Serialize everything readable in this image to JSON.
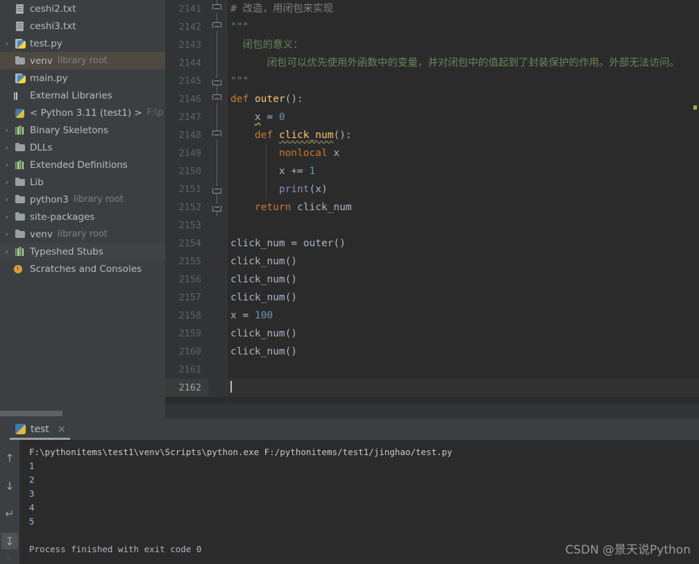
{
  "sidebar": {
    "items": [
      {
        "arrow": "",
        "icon": "text-file-icon",
        "label": "ceshi2.txt",
        "sub": "",
        "state": "normal"
      },
      {
        "arrow": "",
        "icon": "text-file-icon",
        "label": "ceshi3.txt",
        "sub": "",
        "state": "normal"
      },
      {
        "arrow": "›",
        "icon": "python-file-icon",
        "label": "test.py",
        "sub": "",
        "state": "normal"
      },
      {
        "arrow": "",
        "icon": "folder-icon",
        "label": "venv",
        "sub": "library root",
        "state": "selected"
      },
      {
        "arrow": "",
        "icon": "python-file-icon",
        "label": "main.py",
        "sub": "",
        "state": "normal"
      },
      {
        "arrow": "",
        "icon": "external-libraries-icon",
        "label": "External Libraries",
        "sub": "",
        "state": "normal"
      },
      {
        "arrow": "",
        "icon": "python-interpreter-icon",
        "label": "< Python 3.11 (test1) >",
        "sub": "F:\\p",
        "state": "normal"
      },
      {
        "arrow": "›",
        "icon": "library-icon",
        "label": "Binary Skeletons",
        "sub": "",
        "state": "normal"
      },
      {
        "arrow": "›",
        "icon": "folder-icon",
        "label": "DLLs",
        "sub": "",
        "state": "normal"
      },
      {
        "arrow": "›",
        "icon": "library-icon",
        "label": "Extended Definitions",
        "sub": "",
        "state": "normal"
      },
      {
        "arrow": "›",
        "icon": "folder-icon",
        "label": "Lib",
        "sub": "",
        "state": "normal"
      },
      {
        "arrow": "›",
        "icon": "folder-icon",
        "label": "python3",
        "sub": "library root",
        "state": "normal"
      },
      {
        "arrow": "›",
        "icon": "folder-icon",
        "label": "site-packages",
        "sub": "",
        "state": "normal"
      },
      {
        "arrow": "›",
        "icon": "folder-icon",
        "label": "venv",
        "sub": "library root",
        "state": "normal"
      },
      {
        "arrow": "›",
        "icon": "library-icon",
        "label": "Typeshed Stubs",
        "sub": "",
        "state": "hl"
      },
      {
        "arrow": "",
        "icon": "scratches-icon",
        "label": "Scratches and Consoles",
        "sub": "",
        "state": "normal"
      }
    ]
  },
  "editor": {
    "first_line_number": 2141,
    "current_line_number": 2162,
    "lines": [
      {
        "n": "2141",
        "fold": "top",
        "html": "<span class=\"c-comment\"># 改造，用闭包来实现</span>"
      },
      {
        "n": "2142",
        "fold": "top",
        "html": "<span class=\"c-str\">\"\"\"</span>"
      },
      {
        "n": "2143",
        "fold": "line",
        "html": "<span class=\"c-str\">  闭包的意义：</span>"
      },
      {
        "n": "2144",
        "fold": "line",
        "html": "<span class=\"c-str\">      闭包可以优先使用外函数中的变量，并对闭包中的值起到了封装保护的作用。外部无法访问。</span>"
      },
      {
        "n": "2145",
        "fold": "bot",
        "html": "<span class=\"c-str\">\"\"\"</span>"
      },
      {
        "n": "2146",
        "fold": "top",
        "html": "<span class=\"c-kw\">def</span> <span class=\"c-def\">outer</span><span class=\"c-plain\">():</span>"
      },
      {
        "n": "2147",
        "fold": "line",
        "html": "<span class=\"c-plain\">    </span><span class=\"c-plain underwave\">x</span><span class=\"c-plain\"> = </span><span class=\"c-num\">0</span>"
      },
      {
        "n": "2148",
        "fold": "top",
        "html": "<span class=\"c-plain\">    </span><span class=\"c-kw\">def</span> <span class=\"c-def underwave-grey\">click_num</span><span class=\"c-plain\">():</span>"
      },
      {
        "n": "2149",
        "fold": "line",
        "html": "<span class=\"c-plain\">        </span><span class=\"c-kw\">nonlocal</span><span class=\"c-plain\"> x</span>"
      },
      {
        "n": "2150",
        "fold": "line",
        "html": "<span class=\"c-plain\">        x += </span><span class=\"c-num\">1</span>"
      },
      {
        "n": "2151",
        "fold": "bot",
        "html": "<span class=\"c-plain\">        </span><span class=\"c-builtin\">print</span><span class=\"c-plain\">(x)</span>"
      },
      {
        "n": "2152",
        "fold": "bot",
        "html": "<span class=\"c-plain\">    </span><span class=\"c-kw\">return</span><span class=\"c-plain\"> click_num</span>"
      },
      {
        "n": "2153",
        "fold": "",
        "html": ""
      },
      {
        "n": "2154",
        "fold": "",
        "html": "<span class=\"c-plain\">click_num = outer()</span>"
      },
      {
        "n": "2155",
        "fold": "",
        "html": "<span class=\"c-plain\">click_num()</span>"
      },
      {
        "n": "2156",
        "fold": "",
        "html": "<span class=\"c-plain\">click_num()</span>"
      },
      {
        "n": "2157",
        "fold": "",
        "html": "<span class=\"c-plain\">click_num()</span>"
      },
      {
        "n": "2158",
        "fold": "",
        "html": "<span class=\"c-plain\">x = </span><span class=\"c-num\">100</span>"
      },
      {
        "n": "2159",
        "fold": "",
        "html": "<span class=\"c-plain\">click_num()</span>"
      },
      {
        "n": "2160",
        "fold": "",
        "html": "<span class=\"c-plain\">click_num()</span>"
      },
      {
        "n": "2161",
        "fold": "",
        "html": ""
      },
      {
        "n": "2162",
        "fold": "",
        "html": "<span class=\"caret\"></span>"
      }
    ]
  },
  "run_panel": {
    "tab": {
      "label": "test",
      "icon": "python-icon",
      "close": "×"
    },
    "toolbar": [
      {
        "name": "scroll-up-button",
        "glyph": "↑",
        "active": false
      },
      {
        "name": "scroll-down-button",
        "glyph": "↓",
        "active": false
      },
      {
        "name": "soft-wrap-button",
        "glyph": "↵",
        "active": false
      },
      {
        "name": "scroll-to-end-button",
        "glyph": "↧",
        "active": true
      }
    ],
    "console_lines": [
      "F:\\pythonitems\\test1\\venv\\Scripts\\python.exe F:/pythonitems/test1/jinghao/test.py",
      "1",
      "2",
      "3",
      "4",
      "5",
      "",
      "Process finished with exit code 0"
    ]
  },
  "watermark": {
    "text": "CSDN @景天说Python"
  },
  "colors": {
    "sidebar_bg": "#3c3f41",
    "editor_bg": "#2b2b2b",
    "gutter_bg": "#313335",
    "selection_bg": "#4e4a42",
    "keyword": "#cc7832",
    "function": "#ffc66d",
    "number": "#6897bb",
    "string": "#6a8759",
    "comment": "#808080",
    "plain_text": "#a9b7c6",
    "builtin": "#8888c6"
  }
}
